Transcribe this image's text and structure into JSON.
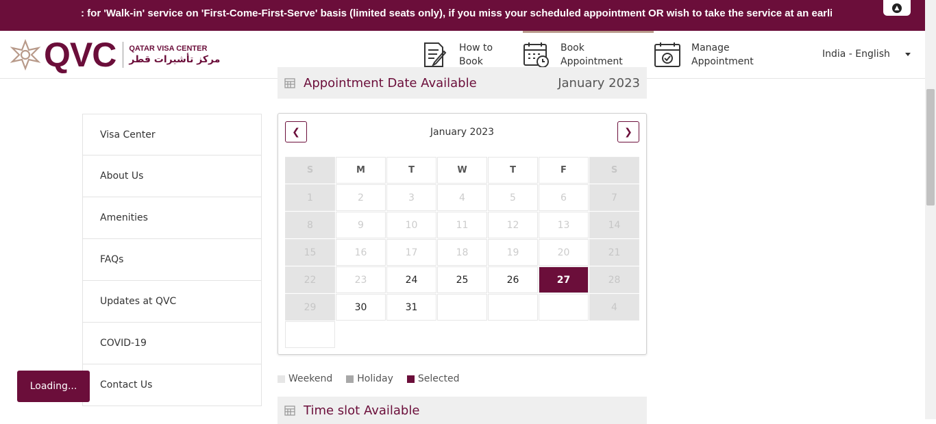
{
  "ticker": {
    "text": ": for 'Walk-in' service on 'First-Come-First-Serve' basis (limited seats only), if you miss your scheduled appointment OR wish to take the service at an earlier d"
  },
  "logo": {
    "brand": "QVC",
    "name_en": "QATAR VISA CENTER",
    "name_ar": "مركز تأشيرات قطر"
  },
  "nav": {
    "items": [
      {
        "line1": "How to",
        "line2": "Book",
        "icon": "document-pen-icon"
      },
      {
        "line1": "Book",
        "line2": "Appointment",
        "icon": "calendar-clock-icon"
      },
      {
        "line1": "Manage",
        "line2": "Appointment",
        "icon": "calendar-check-icon"
      }
    ],
    "language": "India - English"
  },
  "sidebar": {
    "items": [
      "Visa Center",
      "About Us",
      "Amenities",
      "FAQs",
      "Updates at QVC",
      "COVID-19",
      "Contact Us"
    ]
  },
  "loading_label": "Loading...",
  "appointment": {
    "header_label": "Appointment Date Available",
    "header_month": "January 2023",
    "calendar_title": "January  2023",
    "weekdays": [
      "S",
      "M",
      "T",
      "W",
      "T",
      "F",
      "S"
    ],
    "weeks": [
      [
        "1",
        "2",
        "3",
        "4",
        "5",
        "6",
        "7"
      ],
      [
        "8",
        "9",
        "10",
        "11",
        "12",
        "13",
        "14"
      ],
      [
        "15",
        "16",
        "17",
        "18",
        "19",
        "20",
        "21"
      ],
      [
        "22",
        "23",
        "24",
        "25",
        "26",
        "27",
        "28"
      ],
      [
        "29",
        "30",
        "31",
        "",
        "",
        "",
        "4"
      ],
      [
        "",
        "",
        "",
        "",
        "",
        "",
        ""
      ]
    ],
    "available_days": [
      "24",
      "25",
      "26",
      "30",
      "31"
    ],
    "selected_day": "27"
  },
  "legend": {
    "weekend": "Weekend",
    "holiday": "Holiday",
    "selected": "Selected"
  },
  "legend_colors": {
    "weekend": "#e6e6e6",
    "holiday": "#a8a8a8",
    "selected": "#6b0e3a"
  },
  "timeslot": {
    "header_label": "Time slot Available"
  },
  "colors": {
    "brand": "#6b0e3a"
  }
}
